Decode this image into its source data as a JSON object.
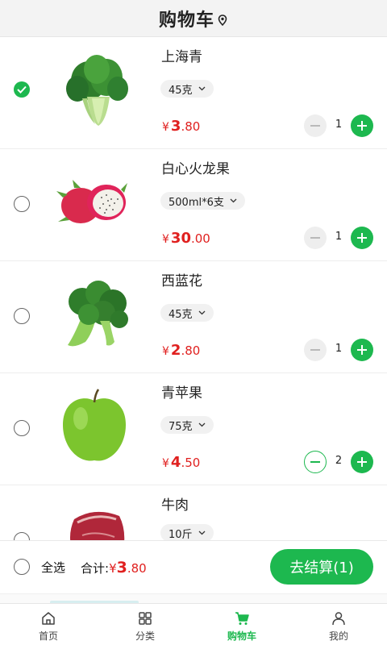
{
  "header": {
    "title": "购物车",
    "location_icon": "location-pin-icon"
  },
  "items": [
    {
      "name": "上海青",
      "spec": "45克",
      "currency": "¥",
      "price_int": "3",
      "price_dec": ".80",
      "qty": "1",
      "selected": true,
      "image": "bok-choy"
    },
    {
      "name": "白心火龙果",
      "spec": "500ml*6支",
      "currency": "¥",
      "price_int": "30",
      "price_dec": ".00",
      "qty": "1",
      "selected": false,
      "image": "dragon-fruit"
    },
    {
      "name": "西蓝花",
      "spec": "45克",
      "currency": "¥",
      "price_int": "2",
      "price_dec": ".80",
      "qty": "1",
      "selected": false,
      "image": "broccoli"
    },
    {
      "name": "青苹果",
      "spec": "75克",
      "currency": "¥",
      "price_int": "4",
      "price_dec": ".50",
      "qty": "2",
      "selected": false,
      "image": "green-apple"
    },
    {
      "name": "牛肉",
      "spec": "10斤",
      "currency": "¥",
      "price_int": "",
      "price_dec": "",
      "qty": "",
      "selected": false,
      "image": "beef"
    }
  ],
  "settle": {
    "select_all_label": "全选",
    "total_label": "合计:",
    "currency": "¥",
    "total_int": "3",
    "total_dec": ".80",
    "checkout_label": "去结算(1)"
  },
  "tabs": [
    {
      "label": "首页",
      "icon": "home-icon",
      "active": false
    },
    {
      "label": "分类",
      "icon": "category-grid-icon",
      "active": false
    },
    {
      "label": "购物车",
      "icon": "cart-icon",
      "active": true
    },
    {
      "label": "我的",
      "icon": "user-icon",
      "active": false
    }
  ],
  "colors": {
    "accent": "#1db84f",
    "price": "#e0201f",
    "header_bg": "#f3f3f3"
  }
}
